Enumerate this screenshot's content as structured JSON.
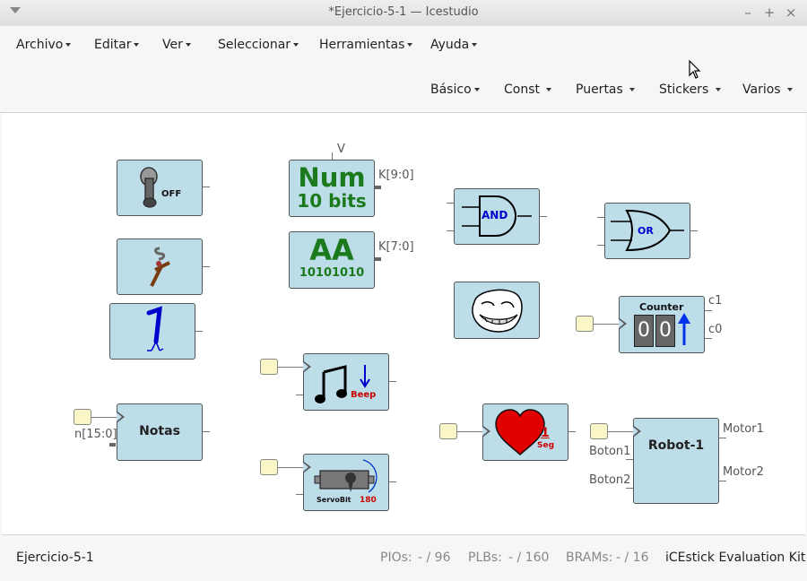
{
  "window": {
    "title": "*Ejercicio-5-1 — Icestudio",
    "minimize": "–",
    "maximize": "+",
    "close": "×"
  },
  "menubar": {
    "items": [
      "Archivo",
      "Editar",
      "Ver",
      "Seleccionar",
      "Herramientas",
      "Ayuda"
    ]
  },
  "toolbar": {
    "items": [
      "Básico",
      "Const",
      "Puertas",
      "Stickers",
      "Varios"
    ]
  },
  "blocks": {
    "off_icon_text": "OFF",
    "num_title": "Num",
    "num_sub": "10 bits",
    "num_port_top": "V",
    "num_port_out": "K[9:0]",
    "aa_title": "AA",
    "aa_sub": "10101010",
    "aa_port_out": "K[7:0]",
    "and_text": "AND",
    "or_text": "OR",
    "counter_title": "Counter",
    "counter_digits": [
      "0",
      "0"
    ],
    "counter_out1": "c1",
    "counter_out0": "c0",
    "notas_label": "Notas",
    "notas_input": "n[15:0]",
    "beep_text": "Beep",
    "servo_text": "ServoBit",
    "servo_angle": "180",
    "heart_num": "1",
    "heart_unit": "Seg",
    "robot_label": "Robot-1",
    "robot_in1": "Boton1",
    "robot_in2": "Boton2",
    "robot_out1": "Motor1",
    "robot_out2": "Motor2"
  },
  "statusbar": {
    "project": "Ejercicio-5-1",
    "pios_label": "PIOs:",
    "pios_value": "- / 96",
    "plbs_label": "PLBs:",
    "plbs_value": "- / 160",
    "brams_label": "BRAMs:",
    "brams_value": "- / 16",
    "board": "iCEstick Evaluation Kit"
  },
  "colors": {
    "block_fill": "#bddde9",
    "pin_fill": "#fbf6c8",
    "const_green": "#1b7a1b",
    "logic_blue": "#0000cc",
    "beep_red": "#cc0000",
    "heart_red": "#e00000"
  }
}
